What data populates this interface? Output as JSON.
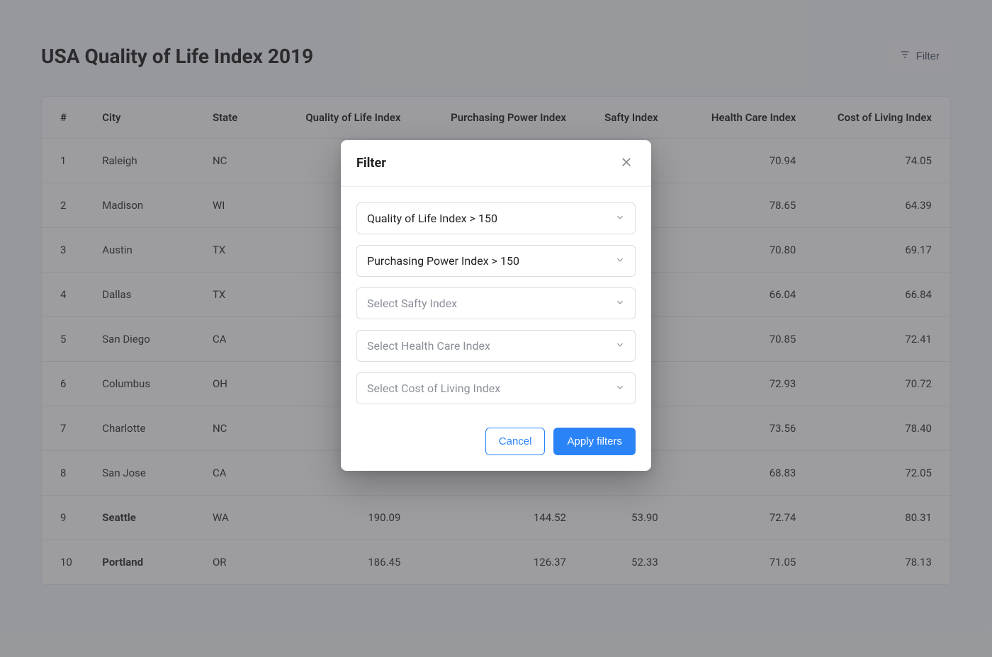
{
  "page": {
    "title": "USA Quality of Life Index 2019",
    "filter_button_label": "Filter"
  },
  "table": {
    "headers": {
      "rank": "#",
      "city": "City",
      "state": "State",
      "qol": "Quality of Life Index",
      "ppi": "Purchasing Power Index",
      "safty": "Safty Index",
      "health": "Health Care Index",
      "cost": "Cost of Living Index"
    },
    "rows": [
      {
        "rank": "1",
        "city": "Raleigh",
        "state": "NC",
        "qol": "",
        "ppi": "",
        "safty": "",
        "health": "70.94",
        "cost": "74.05",
        "bold": false
      },
      {
        "rank": "2",
        "city": "Madison",
        "state": "WI",
        "qol": "",
        "ppi": "",
        "safty": "",
        "health": "78.65",
        "cost": "64.39",
        "bold": false
      },
      {
        "rank": "3",
        "city": "Austin",
        "state": "TX",
        "qol": "",
        "ppi": "",
        "safty": "",
        "health": "70.80",
        "cost": "69.17",
        "bold": false
      },
      {
        "rank": "4",
        "city": "Dallas",
        "state": "TX",
        "qol": "",
        "ppi": "",
        "safty": "",
        "health": "66.04",
        "cost": "66.84",
        "bold": false
      },
      {
        "rank": "5",
        "city": "San Diego",
        "state": "CA",
        "qol": "",
        "ppi": "",
        "safty": "",
        "health": "70.85",
        "cost": "72.41",
        "bold": false
      },
      {
        "rank": "6",
        "city": "Columbus",
        "state": "OH",
        "qol": "",
        "ppi": "",
        "safty": "",
        "health": "72.93",
        "cost": "70.72",
        "bold": false
      },
      {
        "rank": "7",
        "city": "Charlotte",
        "state": "NC",
        "qol": "",
        "ppi": "",
        "safty": "",
        "health": "73.56",
        "cost": "78.40",
        "bold": false
      },
      {
        "rank": "8",
        "city": "San Jose",
        "state": "CA",
        "qol": "",
        "ppi": "",
        "safty": "",
        "health": "68.83",
        "cost": "72.05",
        "bold": false
      },
      {
        "rank": "9",
        "city": "Seattle",
        "state": "WA",
        "qol": "190.09",
        "ppi": "144.52",
        "safty": "53.90",
        "health": "72.74",
        "cost": "80.31",
        "bold": true
      },
      {
        "rank": "10",
        "city": "Portland",
        "state": "OR",
        "qol": "186.45",
        "ppi": "126.37",
        "safty": "52.33",
        "health": "71.05",
        "cost": "78.13",
        "bold": true
      }
    ]
  },
  "modal": {
    "title": "Filter",
    "fields": [
      {
        "text": "Quality of Life Index  > 150",
        "filled": true
      },
      {
        "text": "Purchasing Power Index  > 150",
        "filled": true
      },
      {
        "text": "Select Safty Index",
        "filled": false
      },
      {
        "text": "Select Health Care Index",
        "filled": false
      },
      {
        "text": "Select Cost of Living Index",
        "filled": false
      }
    ],
    "cancel_label": "Cancel",
    "apply_label": "Apply filters"
  }
}
